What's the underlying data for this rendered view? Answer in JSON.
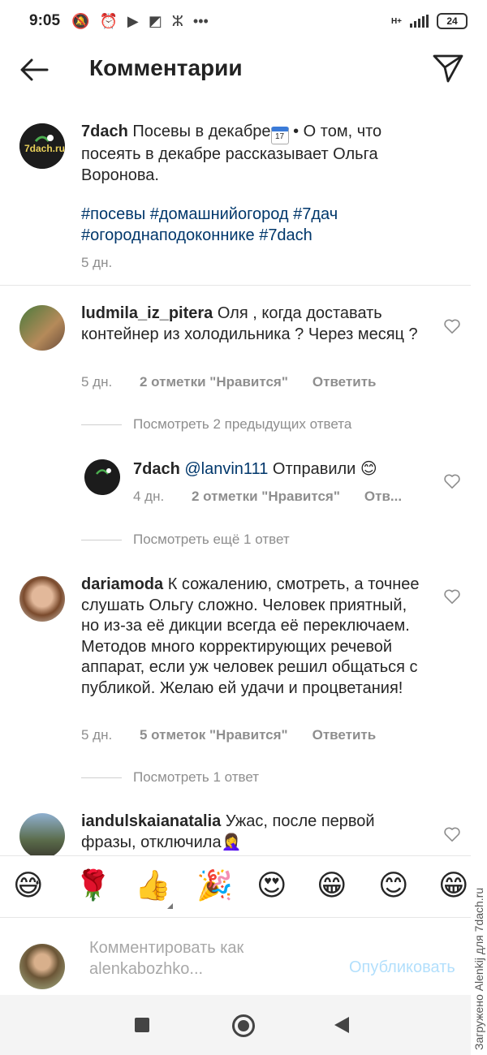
{
  "status_bar": {
    "time": "9:05",
    "network": "H+",
    "battery": "24"
  },
  "header": {
    "title": "Комментарии"
  },
  "post": {
    "username": "7dach",
    "avatar_text": "7dach.ru",
    "caption_part1": "Посевы в декабре",
    "caption_part2": " • О том, что посеять в декабре рассказывает Ольга Воронова.",
    "hashtags_line1": "#посевы #домашнийогород #7дач",
    "hashtags_line2": "#огороднаподоконнике #7dach",
    "time": "5 дн."
  },
  "comments": [
    {
      "username": "ludmila_iz_pitera",
      "text": "Оля , когда доставать контейнер из холодильника ? Через месяц ?",
      "time": "5 дн.",
      "likes": "2 отметки \"Нравится\"",
      "reply_label": "Ответить",
      "view_replies": "Посмотреть 2 предыдущих ответа",
      "reply": {
        "username": "7dach",
        "mention": "@lanvin111",
        "text": " Отправили 😊",
        "time": "4 дн.",
        "likes": "2 отметки \"Нравится\"",
        "reply_label": "Отв..."
      },
      "view_more": "Посмотреть ещё 1 ответ"
    },
    {
      "username": "dariamoda",
      "text": "К сожалению, смотреть, а точнее слушать Ольгу сложно. Человек приятный, но из-за её дикции всегда её переключаем. Методов много корректирующих речевой аппарат, если уж человек решил общаться с публикой. Желаю ей удачи и процветания!",
      "time": "5 дн.",
      "likes": "5 отметок \"Нравится\"",
      "reply_label": "Ответить",
      "view_replies": "Посмотреть 1 ответ"
    },
    {
      "username": "iandulskaianatalia",
      "text": "Ужас, после первой фразы, отключила🤦‍♀️"
    }
  ],
  "emoji_bar": [
    "😅",
    "🌹",
    "👍",
    "🎉",
    "😍",
    "😁",
    "😊",
    "😁"
  ],
  "compose": {
    "placeholder_line1": "Комментировать как",
    "placeholder_line2": "alenkabozhko...",
    "publish_label": "Опубликовать"
  },
  "watermark": "Загружено Alenkij для 7dach.ru",
  "colors": {
    "text": "#262626",
    "secondary": "#8e8e8e",
    "link": "#00376b",
    "publish_disabled": "#b2dffc"
  }
}
